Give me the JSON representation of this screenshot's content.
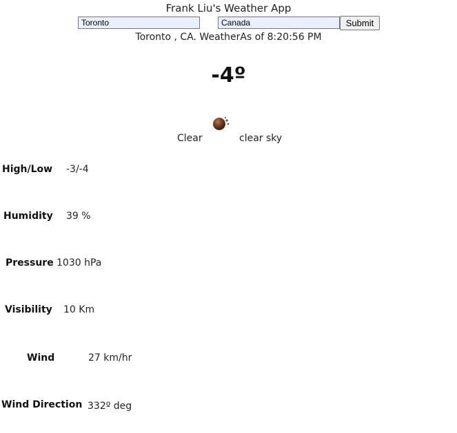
{
  "app": {
    "title": "Frank Liu's Weather App"
  },
  "search": {
    "city_value": "Toronto",
    "country_value": "Canada",
    "submit_label": "Submit"
  },
  "current": {
    "location_line": "Toronto , CA. WeatherAs of 8:20:56 PM",
    "temperature": "-4º",
    "condition_main": "Clear",
    "condition_description": "clear sky",
    "icon": "clear-night-icon"
  },
  "details": {
    "high_low": {
      "label": "High/Low",
      "value": "-3/-4"
    },
    "humidity": {
      "label": "Humidity",
      "value": "39 %"
    },
    "pressure": {
      "label": "Pressure",
      "value": "1030 hPa"
    },
    "visibility": {
      "label": "Visibility",
      "value": "10 Km"
    },
    "wind": {
      "label": "Wind",
      "value": "27 km/hr"
    },
    "wind_direction": {
      "label": "Wind Direction",
      "value": "332º deg"
    }
  }
}
